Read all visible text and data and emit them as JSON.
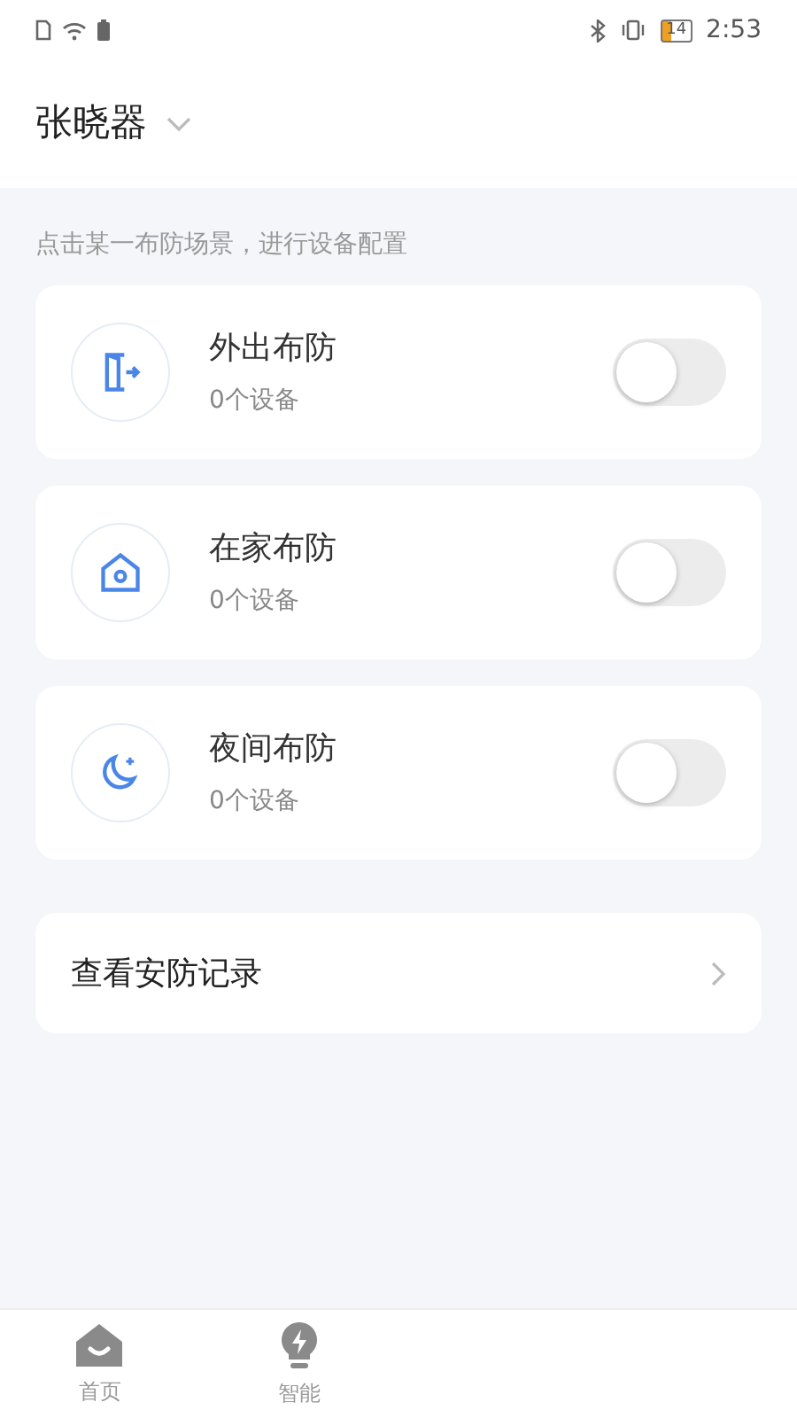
{
  "status_bar": {
    "time": "2:53",
    "battery": "14"
  },
  "header": {
    "title": "张晓器"
  },
  "hint": "点击某一布防场景，进行设备配置",
  "scenes": [
    {
      "kind": "away",
      "name": "外出布防",
      "count": "0个设备",
      "on": false
    },
    {
      "kind": "home",
      "name": "在家布防",
      "count": "0个设备",
      "on": false
    },
    {
      "kind": "night",
      "name": "夜间布防",
      "count": "0个设备",
      "on": false
    }
  ],
  "records_link": "查看安防记录",
  "tab_bar": [
    {
      "kind": "home",
      "label": "首页",
      "selected": false
    },
    {
      "kind": "smart",
      "label": "智能",
      "selected": false
    }
  ]
}
